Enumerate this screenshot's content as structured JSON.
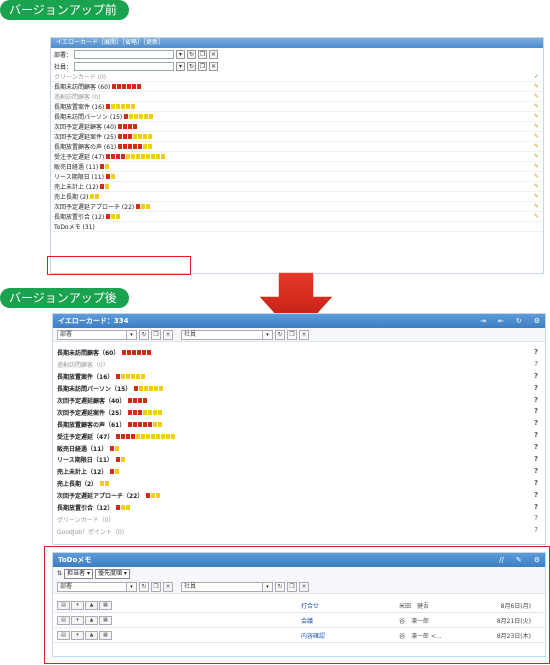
{
  "labels": {
    "before": "バージョンアップ前",
    "after": "バージョンアップ後"
  },
  "old": {
    "header": "イエローカード［展開］［省略］［更新］",
    "dept_label": "部署：",
    "staff_label": "社員：",
    "items": [
      {
        "text": "グリーンカード (0)",
        "muted": true,
        "blocks": "",
        "icon": "✓"
      },
      {
        "text": "長期未訪問顧客 (60)",
        "muted": false,
        "blocks": "rrrrrr",
        "icon": "✎"
      },
      {
        "text": "過剰訪問顧客 (0)",
        "muted": true,
        "blocks": "",
        "icon": "✎"
      },
      {
        "text": "長期放置案件 (16)",
        "muted": false,
        "blocks": "ryyyyy",
        "icon": "✎"
      },
      {
        "text": "長期未訪問パーソン (15)",
        "muted": false,
        "blocks": "ryyyyy",
        "icon": "✎"
      },
      {
        "text": "次回予定遅延顧客 (40)",
        "muted": false,
        "blocks": "rrrr",
        "icon": "✎"
      },
      {
        "text": "次回予定遅延案件 (25)",
        "muted": false,
        "blocks": "rrryyyy",
        "icon": "✎"
      },
      {
        "text": "長期放置顧客の声 (61)",
        "muted": false,
        "blocks": "rrrrryy",
        "icon": "✎"
      },
      {
        "text": "受注予定遅延 (47)",
        "muted": false,
        "blocks": "rrrryyyyyyyy",
        "icon": "✎"
      },
      {
        "text": "販売日経過 (11)",
        "muted": false,
        "blocks": "ry",
        "icon": "✎"
      },
      {
        "text": "リース期限日 (11)",
        "muted": false,
        "blocks": "ry",
        "icon": "✎"
      },
      {
        "text": "売上未計上 (12)",
        "muted": false,
        "blocks": "ry",
        "icon": "✎"
      },
      {
        "text": "売上長期 (2)",
        "muted": false,
        "blocks": "yy",
        "icon": "✎"
      },
      {
        "text": "次回予定遅延アプローチ (22)",
        "muted": false,
        "blocks": "ryy",
        "icon": "✎"
      },
      {
        "text": "長期放置引合 (12)",
        "muted": false,
        "blocks": "ryy",
        "icon": "✎"
      },
      {
        "text": "ToDoメモ (31)",
        "muted": false,
        "blocks": "",
        "icon": ""
      }
    ]
  },
  "new": {
    "header": "イエローカード：334",
    "dept_placeholder": "部署",
    "staff_placeholder": "社員",
    "items": [
      {
        "text": "長期未訪問顧客（60）",
        "bold": true,
        "muted": false,
        "blocks": "rrrrrr"
      },
      {
        "text": "過剰訪問顧客（0）",
        "bold": false,
        "muted": true,
        "blocks": ""
      },
      {
        "text": "長期放置案件（16）",
        "bold": true,
        "muted": false,
        "blocks": "ryyyyy"
      },
      {
        "text": "長期未訪問パーソン（15）",
        "bold": true,
        "muted": false,
        "blocks": "ryyyyy"
      },
      {
        "text": "次回予定遅延顧客（40）",
        "bold": true,
        "muted": false,
        "blocks": "rrrr"
      },
      {
        "text": "次回予定遅延案件（25）",
        "bold": true,
        "muted": false,
        "blocks": "rrryyyy"
      },
      {
        "text": "長期放置顧客の声（61）",
        "bold": true,
        "muted": false,
        "blocks": "rrrrryy"
      },
      {
        "text": "受注予定遅延（47）",
        "bold": true,
        "muted": false,
        "blocks": "rrrryyyyyyyy"
      },
      {
        "text": "販売日経過（11）",
        "bold": true,
        "muted": false,
        "blocks": "ry"
      },
      {
        "text": "リース期限日（11）",
        "bold": true,
        "muted": false,
        "blocks": "ry"
      },
      {
        "text": "売上未計上（12）",
        "bold": true,
        "muted": false,
        "blocks": "ry"
      },
      {
        "text": "売上長期（2）",
        "bold": true,
        "muted": false,
        "blocks": "yy"
      },
      {
        "text": "次回予定遅延アプローチ（22）",
        "bold": true,
        "muted": false,
        "blocks": "ryy"
      },
      {
        "text": "長期放置引合（12）",
        "bold": true,
        "muted": false,
        "blocks": "ryy"
      },
      {
        "text": "グリーンカード（0）",
        "bold": false,
        "muted": true,
        "blocks": ""
      },
      {
        "text": "GoodJob！ポイント（0）",
        "bold": false,
        "muted": true,
        "blocks": ""
      }
    ]
  },
  "todo": {
    "header": "ToDoメモ",
    "select1": "担当者",
    "select2": "優先度順",
    "dept_placeholder": "部署",
    "staff_placeholder": "社員",
    "rows": [
      {
        "title": "打合せ",
        "who": "米田　健吾",
        "date": "8月6日(月)"
      },
      {
        "title": "会議",
        "who": "谷　凛一郎",
        "date": "8月21日(火)"
      },
      {
        "title": "内容確認",
        "who": "谷　凛一郎 <...",
        "date": "8月23日(木)"
      }
    ]
  },
  "colors": {
    "green": "#1aa24f",
    "red": "#d42b18",
    "yellow": "#f3cc17",
    "highlight": "#e21f1f"
  }
}
